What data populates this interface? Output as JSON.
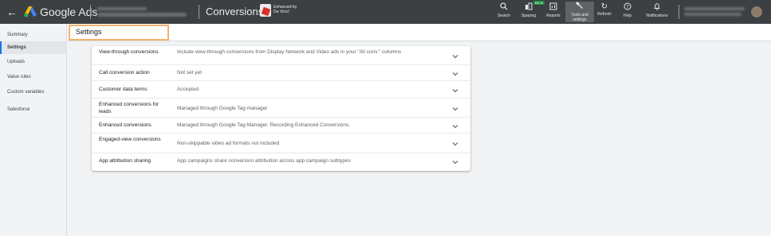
{
  "topbar": {
    "brand": "Google Ads",
    "page_title": "Conversions",
    "enhanced_line1": "Enhanced by",
    "enhanced_line2": "Da Vinci!",
    "beta_label": "BETA",
    "tools": [
      {
        "icon": "search-icon",
        "label": "Search"
      },
      {
        "icon": "spacing-icon",
        "label": "Spacing"
      },
      {
        "icon": "reports-icon",
        "label": "Reports"
      },
      {
        "icon": "tools-icon",
        "label_line1": "Tools and",
        "label_line2": "settings"
      },
      {
        "icon": "refresh-icon",
        "label": "Refresh"
      },
      {
        "icon": "help-icon",
        "label": "Help"
      },
      {
        "icon": "notifications-icon",
        "label": "Notifications"
      }
    ]
  },
  "sidebar": {
    "items": [
      {
        "label": "Summary",
        "active": false
      },
      {
        "label": "Settings",
        "active": true
      },
      {
        "label": "Uploads",
        "active": false
      },
      {
        "label": "Value rules",
        "active": false
      },
      {
        "label": "Custom variables",
        "active": false
      },
      {
        "label": "Salesforce",
        "active": false
      }
    ]
  },
  "main": {
    "title": "Settings",
    "rows": [
      {
        "label": "View-through conversions",
        "value": "Include view-through conversions from Display Network and Video ads in your \"All conv.\" columns"
      },
      {
        "label": "Call conversion action",
        "value": "Not set yet"
      },
      {
        "label": "Customer data terms",
        "value": "Accepted"
      },
      {
        "label": "Enhanced conversions for leads",
        "value": "Managed through Google Tag manager"
      },
      {
        "label": "Enhanced conversions",
        "value": "Managed through Google Tag Manager. Recording Enhanced Conversions."
      },
      {
        "label": "Engaged-view conversions",
        "value": "Non-skippable video ad formats not included"
      },
      {
        "label": "App attribution sharing",
        "value": "App campaigns share conversion attribution across app campaign subtypes"
      }
    ]
  },
  "colors": {
    "topbar": "#3c4043",
    "accent": "#1a73e8",
    "highlight": "#f6b26b"
  }
}
